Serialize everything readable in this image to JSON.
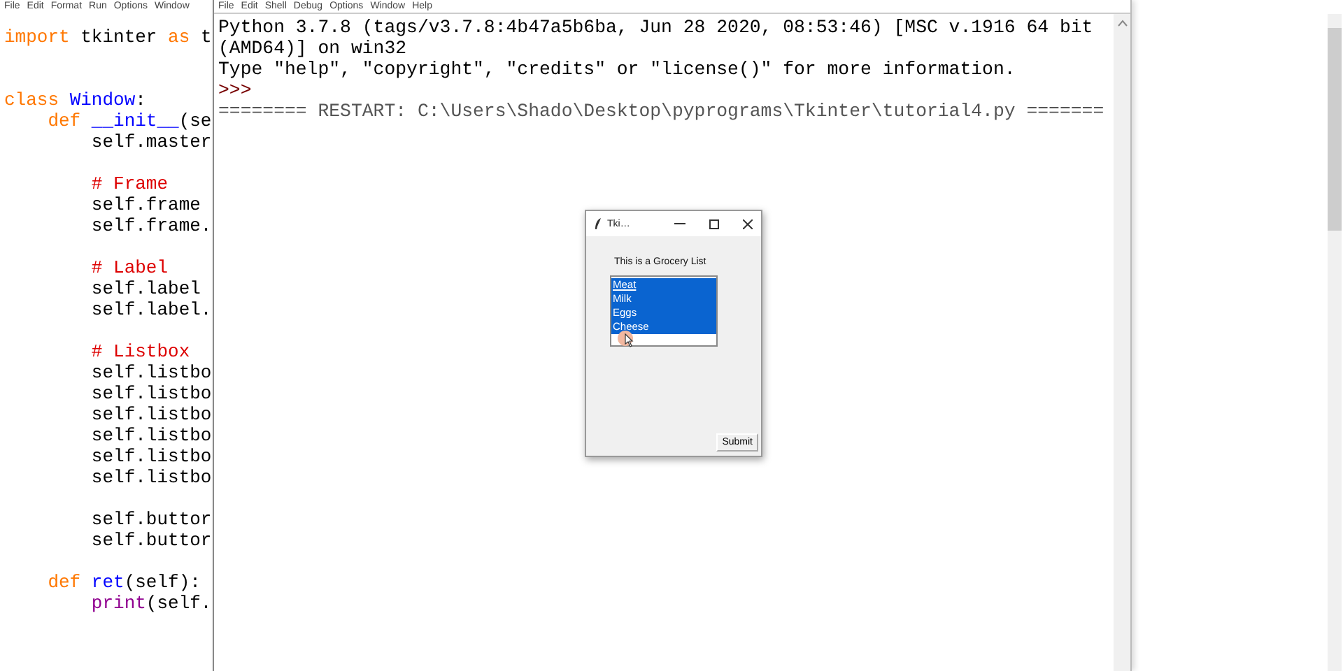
{
  "editor": {
    "menu": [
      "File",
      "Edit",
      "Format",
      "Run",
      "Options",
      "Window"
    ],
    "blocks": [
      {
        "lines": [
          [
            {
              "kind": "keyword",
              "text": "import"
            },
            {
              "kind": "plain",
              "text": " tkinter "
            },
            {
              "kind": "keyword",
              "text": "as"
            },
            {
              "kind": "plain",
              "text": " t"
            }
          ]
        ]
      },
      {
        "lines": [
          [
            {
              "kind": "keyword",
              "text": "class"
            },
            {
              "kind": "name",
              "text": " Window"
            },
            {
              "kind": "plain",
              "text": ":"
            }
          ],
          [
            {
              "kind": "keyword",
              "text": "    def"
            },
            {
              "kind": "name",
              "text": " __init__"
            },
            {
              "kind": "plain",
              "text": "(se"
            }
          ],
          [
            {
              "kind": "plain",
              "text": "        self.master"
            }
          ]
        ]
      },
      {
        "lines": [
          [
            {
              "kind": "comment",
              "text": "        # Frame"
            }
          ],
          [
            {
              "kind": "plain",
              "text": "        self.frame"
            }
          ],
          [
            {
              "kind": "plain",
              "text": "        self.frame."
            }
          ]
        ]
      },
      {
        "lines": [
          [
            {
              "kind": "comment",
              "text": "        # Label"
            }
          ],
          [
            {
              "kind": "plain",
              "text": "        self.label"
            }
          ],
          [
            {
              "kind": "plain",
              "text": "        self.label."
            }
          ]
        ]
      },
      {
        "lines": [
          [
            {
              "kind": "comment",
              "text": "        # Listbox"
            }
          ],
          [
            {
              "kind": "plain",
              "text": "        self.listbo"
            }
          ],
          [
            {
              "kind": "plain",
              "text": "        self.listbo"
            }
          ],
          [
            {
              "kind": "plain",
              "text": "        self.listbo"
            }
          ],
          [
            {
              "kind": "plain",
              "text": "        self.listbo"
            }
          ],
          [
            {
              "kind": "plain",
              "text": "        self.listbo"
            }
          ],
          [
            {
              "kind": "plain",
              "text": "        self.listbo"
            }
          ]
        ]
      },
      {
        "lines": [
          [
            {
              "kind": "plain",
              "text": "        self.buttor"
            }
          ],
          [
            {
              "kind": "plain",
              "text": "        self.buttor"
            }
          ]
        ]
      },
      {
        "lines": [
          [
            {
              "kind": "keyword",
              "text": "    def"
            },
            {
              "kind": "name",
              "text": " ret"
            },
            {
              "kind": "plain",
              "text": "(self):"
            }
          ],
          [
            {
              "kind": "builtin",
              "text": "        print"
            },
            {
              "kind": "plain",
              "text": "(self."
            }
          ]
        ]
      }
    ]
  },
  "shell": {
    "menu": [
      "File",
      "Edit",
      "Shell",
      "Debug",
      "Options",
      "Window",
      "Help"
    ],
    "lines": [
      {
        "kind": "output",
        "text": "Python 3.7.8 (tags/v3.7.8:4b47a5b6ba, Jun 28 2020, 08:53:46) [MSC v.1916 64 bit"
      },
      {
        "kind": "output",
        "text": "(AMD64)] on win32"
      },
      {
        "kind": "output",
        "text": "Type \"help\", \"copyright\", \"credits\" or \"license()\" for more information."
      },
      {
        "kind": "prompt",
        "text": ">>>"
      },
      {
        "kind": "restart",
        "text": "======== RESTART: C:\\Users\\Shado\\Desktop\\pyprograms\\Tkinter\\tutorial4.py ======="
      }
    ]
  },
  "tk_window": {
    "title": "Tki…",
    "label": "This is a Grocery List",
    "items": [
      {
        "text": "Meat",
        "selected": true,
        "active": true
      },
      {
        "text": "Milk",
        "selected": true,
        "active": false
      },
      {
        "text": "Eggs",
        "selected": true,
        "active": false
      },
      {
        "text": "Cheese",
        "selected": true,
        "active": false
      }
    ],
    "button": "Submit"
  }
}
